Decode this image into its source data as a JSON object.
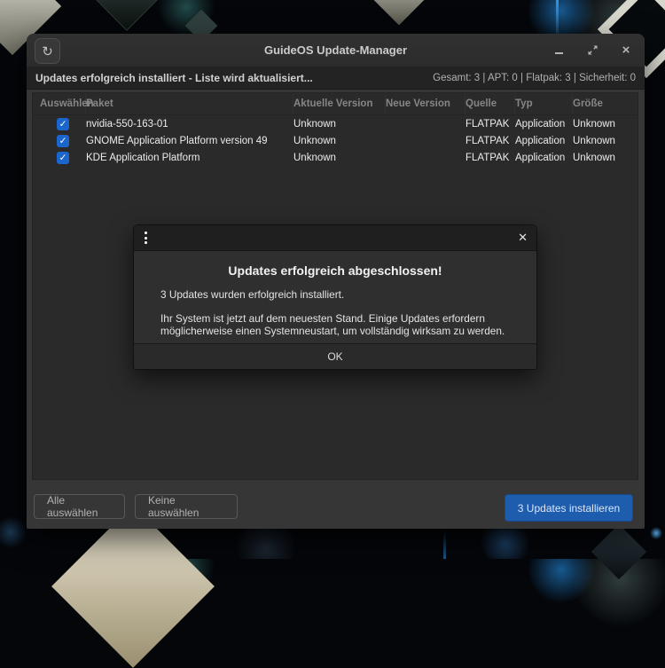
{
  "window": {
    "title": "GuideOS Update-Manager",
    "refresh_icon": "↻",
    "close_icon": "×"
  },
  "statusbar": {
    "message": "Updates erfolgreich installiert - Liste wird aktualisiert...",
    "summary": "Gesamt: 3 | APT: 0 | Flatpak: 3 | Sicherheit: 0"
  },
  "table": {
    "columns": [
      "Auswählen",
      "Paket",
      "Aktuelle Version",
      "Neue Version",
      "Quelle",
      "Typ",
      "Größe"
    ],
    "checkmark": "✓",
    "rows": [
      {
        "selected": true,
        "paket": "nvidia-550-163-01",
        "aktuelle_version": "Unknown",
        "neue_version": "",
        "quelle": "FLATPAK",
        "typ": "Application",
        "groesse": "Unknown"
      },
      {
        "selected": true,
        "paket": "GNOME Application Platform version 49",
        "aktuelle_version": "Unknown",
        "neue_version": "",
        "quelle": "FLATPAK",
        "typ": "Application",
        "groesse": "Unknown"
      },
      {
        "selected": true,
        "paket": "KDE Application Platform",
        "aktuelle_version": "Unknown",
        "neue_version": "",
        "quelle": "FLATPAK",
        "typ": "Application",
        "groesse": "Unknown"
      }
    ]
  },
  "dialog": {
    "close_icon": "✕",
    "title": "Updates erfolgreich abgeschlossen!",
    "line1": "3 Updates wurden erfolgreich installiert.",
    "line2": "Ihr System ist jetzt auf dem neuesten Stand. Einige Updates erfordern möglicherweise einen Systemneustart, um vollständig wirksam zu werden.",
    "ok_label": "OK"
  },
  "actions": {
    "select_all": "Alle auswählen",
    "select_none": "Keine auswählen",
    "install": "3 Updates installieren"
  },
  "colors": {
    "accent_button_blue": "#1e5cad",
    "checkbox_blue": "#1a66cc",
    "window_bg": "#363636",
    "table_bg": "#2a2a2a"
  }
}
